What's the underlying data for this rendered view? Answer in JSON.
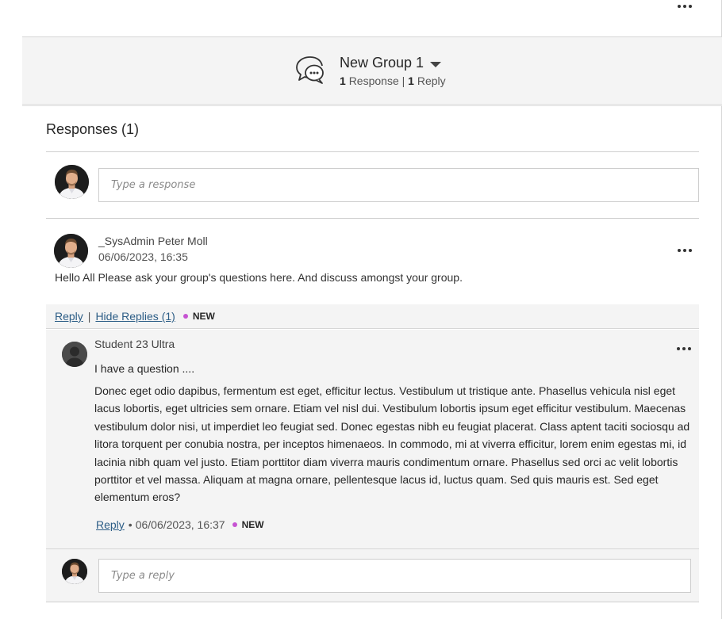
{
  "top_menu": {
    "icon": "more-horizontal-icon"
  },
  "group": {
    "title": "New Group 1",
    "responses_count": "1",
    "responses_label": "Response",
    "separator": "|",
    "replies_count": "1",
    "replies_label": "Reply",
    "icon": "discussion-bubbles-icon"
  },
  "responses": {
    "heading": "Responses (1)",
    "input_placeholder": "Type a response"
  },
  "post": {
    "author": "_SysAdmin Peter Moll",
    "date": "06/06/2023, 16:35",
    "body": "Hello All Please ask your group's questions here. And discuss amongst your group.",
    "reply_label": "Reply",
    "separator": "|",
    "hide_replies_label": "Hide Replies (1)",
    "new_label": "NEW"
  },
  "reply": {
    "author": "Student 23 Ultra",
    "subject": "I have a question ....",
    "body": "Donec eget odio dapibus, fermentum est eget, efficitur lectus. Vestibulum ut tristique ante. Phasellus vehicula nisl eget lacus lobortis, eget ultricies sem ornare. Etiam vel nisl dui. Vestibulum lobortis ipsum eget efficitur vestibulum. Maecenas vestibulum dolor nisi, ut imperdiet leo feugiat sed. Donec egestas nibh eu feugiat placerat. Class aptent taciti sociosqu ad litora torquent per conubia nostra, per inceptos himenaeos. In commodo, mi at viverra efficitur, lorem enim egestas mi, id lacinia nibh quam vel justo. Etiam porttitor diam viverra mauris condimentum ornare. Phasellus sed orci ac velit lobortis porttitor et vel massa. Aliquam at magna ornare, pellentesque lacus id, luctus quam. Sed quis mauris est. Sed eget elementum eros?",
    "reply_label": "Reply",
    "bullet": "•",
    "date": "06/06/2023, 16:37",
    "new_label": "NEW",
    "input_placeholder": "Type a reply"
  },
  "colors": {
    "link": "#2c5d86",
    "new_dot": "#c653d2",
    "panel_bg": "#f4f4f4"
  }
}
